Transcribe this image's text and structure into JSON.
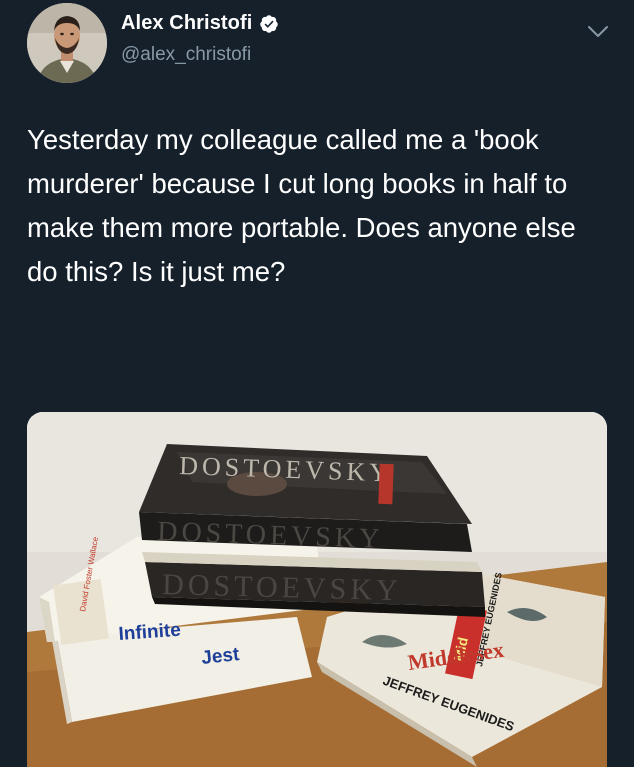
{
  "author": {
    "name": "Alex Christofi",
    "handle": "@alex_christofi",
    "verified_icon": "verified-badge-icon"
  },
  "tweet": {
    "text": "Yesterday my colleague called me a 'book murderer' because I cut long books in half to make them more portable. Does anyone else do this? Is it just me?"
  },
  "menu": {
    "icon": "chevron-down-icon"
  },
  "photo": {
    "book_top": "DOSTOEVSKY",
    "book_top_half": "DOSTOEVSKY",
    "book_left_title": "Infinite",
    "book_left_title2": "Jest",
    "book_left_spine": "David Foster Wallace",
    "book_right_title": "Middlesex",
    "book_right_author": "JEFFREY EUGENIDES",
    "book_right_spine": "JEFFREY EUGENIDES",
    "book_right_spine_title": "Mid"
  },
  "colors": {
    "background": "#15202b",
    "secondary_text": "#8899a6",
    "verified_blue": "#ffffff"
  }
}
